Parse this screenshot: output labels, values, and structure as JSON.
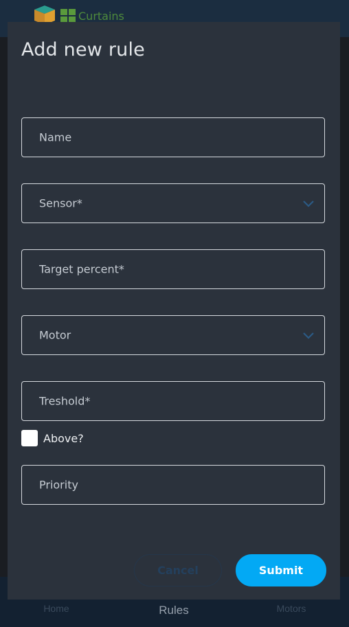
{
  "app": {
    "logo_text": "Curtains"
  },
  "nav": {
    "items": [
      {
        "label": "Home",
        "active": false
      },
      {
        "label": "Rules",
        "active": true
      },
      {
        "label": "Motors",
        "active": false
      }
    ]
  },
  "dialog": {
    "title": "Add new rule",
    "fields": {
      "name": {
        "label": "Name",
        "type": "text"
      },
      "sensor": {
        "label": "Sensor*",
        "type": "select"
      },
      "target_percent": {
        "label": "Target percent*",
        "type": "text"
      },
      "motor": {
        "label": "Motor",
        "type": "select"
      },
      "threshold": {
        "label": "Treshold*",
        "type": "text"
      },
      "priority": {
        "label": "Priority",
        "type": "text"
      }
    },
    "above": {
      "label": "Above?",
      "checked": false
    },
    "buttons": {
      "cancel": "Cancel",
      "submit": "Submit"
    }
  },
  "colors": {
    "accent": "#03a9f4",
    "dialog_bg": "#2b323c",
    "header_bg": "#1b2d40",
    "nav_bg": "#132131"
  }
}
